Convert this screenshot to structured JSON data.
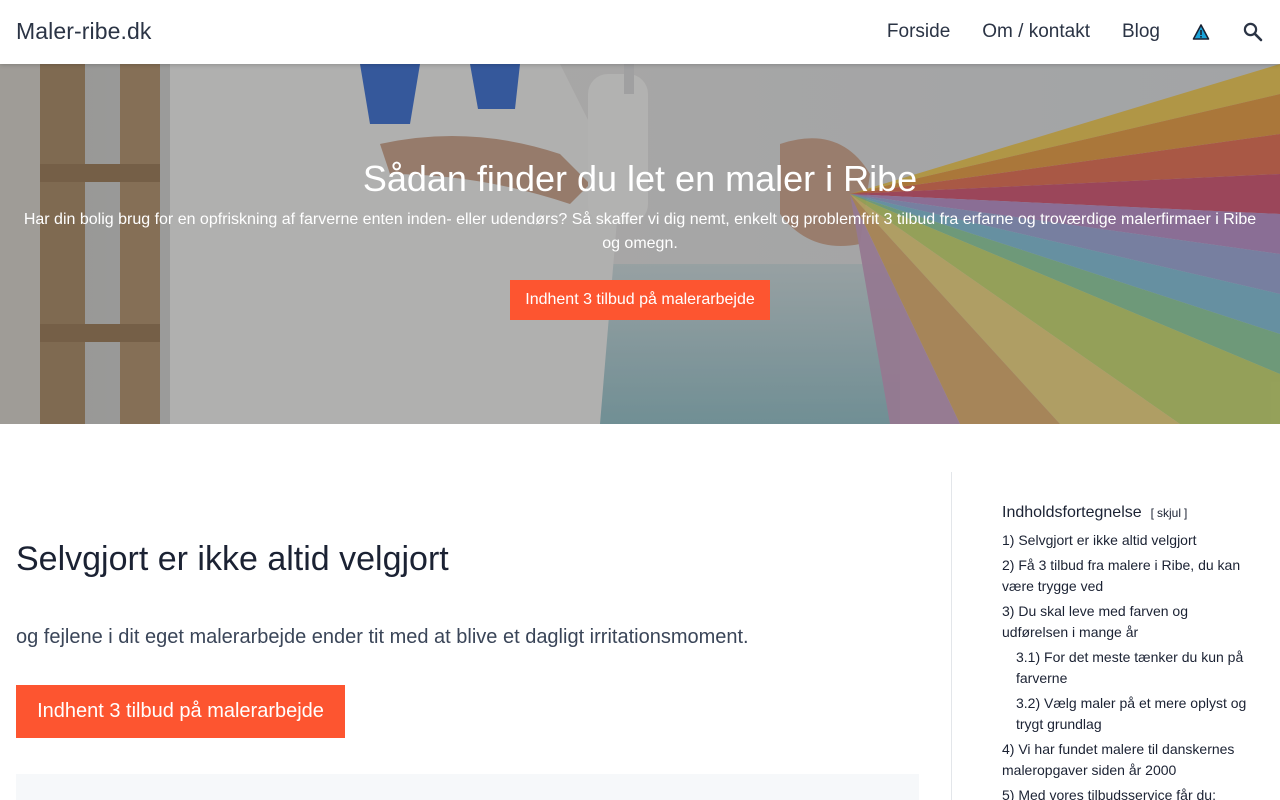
{
  "header": {
    "logo": "Maler-ribe.dk",
    "nav": [
      "Forside",
      "Om / kontakt",
      "Blog"
    ]
  },
  "hero": {
    "title": "Sådan finder du let en maler i Ribe",
    "text": "Har din bolig brug for en opfriskning af farverne enten inden- eller udendørs? Så skaffer vi dig nemt, enkelt og problemfrit 3 tilbud fra erfarne og troværdige malerfirmaer i Ribe og omegn.",
    "button": "Indhent 3 tilbud på malerarbejde"
  },
  "main": {
    "heading": "Selvgjort er ikke altid velgjort",
    "lead": "og fejlene i dit eget malerarbejde ender tit med at blive et dagligt irritationsmoment.",
    "button": "Indhent 3 tilbud på malerarbejde"
  },
  "toc": {
    "title": "Indholdsfortegnelse",
    "toggle_open": "[",
    "toggle_label": "skjul",
    "toggle_close": "]",
    "items": [
      {
        "text": "1) Selvgjort er ikke altid velgjort",
        "sub": false
      },
      {
        "text": "2) Få 3 tilbud fra malere i Ribe, du kan være trygge ved",
        "sub": false
      },
      {
        "text": "3) Du skal leve med farven og udførelsen i mange år",
        "sub": false
      },
      {
        "text": "3.1) For det meste tænker du kun på farverne",
        "sub": true
      },
      {
        "text": "3.2) Vælg maler på et mere oplyst og trygt grundlag",
        "sub": true
      },
      {
        "text": "4) Vi har fundet malere til danskernes maleropgaver siden år 2000",
        "sub": false
      },
      {
        "text": "5) Med vores tilbudsservice får du:",
        "sub": false
      }
    ]
  },
  "colors": {
    "accent": "#fd5530",
    "text": "#1b2233",
    "warning_icon": "#1aa3d9"
  },
  "icons": {
    "warning": "warning-triangle-icon",
    "search": "search-icon"
  }
}
